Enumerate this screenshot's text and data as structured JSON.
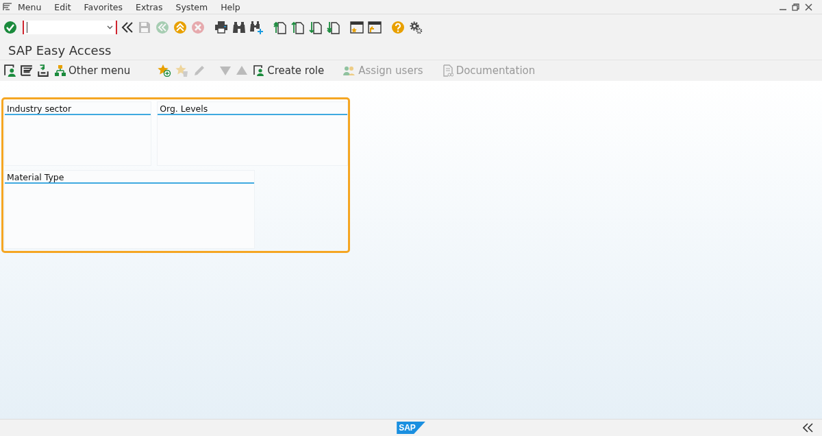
{
  "menu_bar": [
    "Menu",
    "Edit",
    "Favorites",
    "Extras",
    "System",
    "Help"
  ],
  "system_toolbar": {
    "buttons": [
      {
        "kind": "collapse",
        "disabled": false
      },
      {
        "kind": "save",
        "disabled": true
      },
      {
        "kind": "back",
        "disabled": true
      },
      {
        "kind": "exit",
        "disabled": false
      },
      {
        "kind": "cancel",
        "disabled": true
      },
      {
        "kind": "print",
        "disabled": false
      },
      {
        "kind": "find",
        "disabled": false
      },
      {
        "kind": "find-next",
        "disabled": false
      },
      {
        "kind": "first-page",
        "disabled": false
      },
      {
        "kind": "prev-page",
        "disabled": false
      },
      {
        "kind": "next-page",
        "disabled": false
      },
      {
        "kind": "last-page",
        "disabled": false
      },
      {
        "kind": "new-session",
        "disabled": false
      },
      {
        "kind": "shortcut",
        "disabled": false
      },
      {
        "kind": "help",
        "disabled": false
      },
      {
        "kind": "settings",
        "disabled": false
      }
    ]
  },
  "title": "SAP Easy Access",
  "app_toolbar": [
    {
      "kind": "user-menu",
      "disabled": false
    },
    {
      "kind": "sap-menu",
      "disabled": false
    },
    {
      "kind": "tray",
      "disabled": false
    },
    {
      "kind": "hierarchy",
      "label": "Other menu",
      "disabled": false
    },
    {
      "kind": "add-favorite",
      "disabled": false
    },
    {
      "kind": "delete-favorite",
      "disabled": true
    },
    {
      "kind": "pencil",
      "disabled": true
    },
    {
      "kind": "down",
      "disabled": true
    },
    {
      "kind": "up",
      "disabled": true
    },
    {
      "kind": "user-menu",
      "label": "Create role",
      "disabled": false
    },
    {
      "kind": "users",
      "label": "Assign users",
      "disabled": true
    },
    {
      "kind": "document",
      "label": "Documentation",
      "disabled": true
    }
  ],
  "panels": [
    {
      "title": "Industry sector"
    },
    {
      "title": "Org. Levels"
    },
    {
      "title": "Material Type"
    }
  ],
  "footer": {
    "logo": "SAP"
  }
}
